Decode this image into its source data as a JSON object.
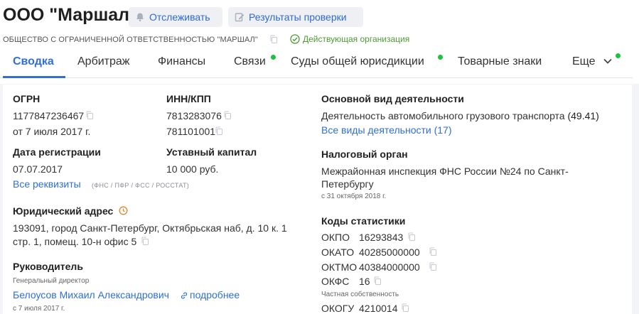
{
  "header": {
    "title": "ООО \"Маршал\"",
    "track_button": "Отслеживать",
    "check_button": "Результаты проверки",
    "full_name": "ОБЩЕСТВО С ОГРАНИЧЕННОЙ ОТВЕТСТВЕННОСТЬЮ \"МАРШАЛ\"",
    "status": "Действующая организация"
  },
  "colors": {
    "accent": "#2f6fd7",
    "active_status": "#4f9a34",
    "indicator": "#19c43c"
  },
  "tabs": [
    {
      "label": "Сводка",
      "active": true
    },
    {
      "label": "Арбитраж"
    },
    {
      "label": "Финансы"
    },
    {
      "label": "Связи",
      "indicator": true
    },
    {
      "label": "Суды общей юрисдикции",
      "indicator": true
    },
    {
      "label": "Товарные знаки"
    },
    {
      "label": "Еще",
      "indicator": true
    }
  ],
  "left": {
    "ogrn_label": "ОГРН",
    "ogrn_value": "1177847236467",
    "ogrn_date": "от 7 июля 2017 г.",
    "inn_label": "ИНН/КПП",
    "inn_value": "7813283076",
    "kpp_value": "781101001",
    "reg_label": "Дата регистрации",
    "reg_value": "07.07.2017",
    "capital_label": "Уставный капитал",
    "capital_value": "10 000 руб.",
    "all_details_link": "Все реквизиты",
    "details_sources": "(ФНС / ПФР / ФСС / РОССТАТ)",
    "address_label": "Юридический адрес",
    "address_line1": "193091, город Санкт-Петербург, Октябрьская наб, д. 10 к. 1",
    "address_line2": "стр. 1, помещ. 10-н офис 5",
    "head_label": "Руководитель",
    "head_position": "Генеральный директор",
    "head_name": "Белоусов Михаил Александрович",
    "head_more": "подробнее",
    "head_date": "с 7 июля 2017 г."
  },
  "right": {
    "activity_label": "Основной вид деятельности",
    "activity_value": "Деятельность автомобильного грузового транспорта",
    "activity_code": "(49.41)",
    "all_activities_link": "Все виды деятельности (17)",
    "tax_label": "Налоговый орган",
    "tax_line1": "Межрайонная инспекция ФНС России №24 по Санкт-",
    "tax_line2": "Петербургу",
    "tax_date": "с 31 октября 2018 г.",
    "stats_label": "Коды статистики",
    "codes": [
      {
        "name": "ОКПО",
        "value": "16293843"
      },
      {
        "name": "ОКАТО",
        "value": "40285000000"
      },
      {
        "name": "ОКТМО",
        "value": "40384000000"
      },
      {
        "name": "ОКФС",
        "value": "16"
      },
      {
        "name": "ОКОГУ",
        "value": "4210014"
      }
    ],
    "okfs_note": "Частная собственность"
  }
}
